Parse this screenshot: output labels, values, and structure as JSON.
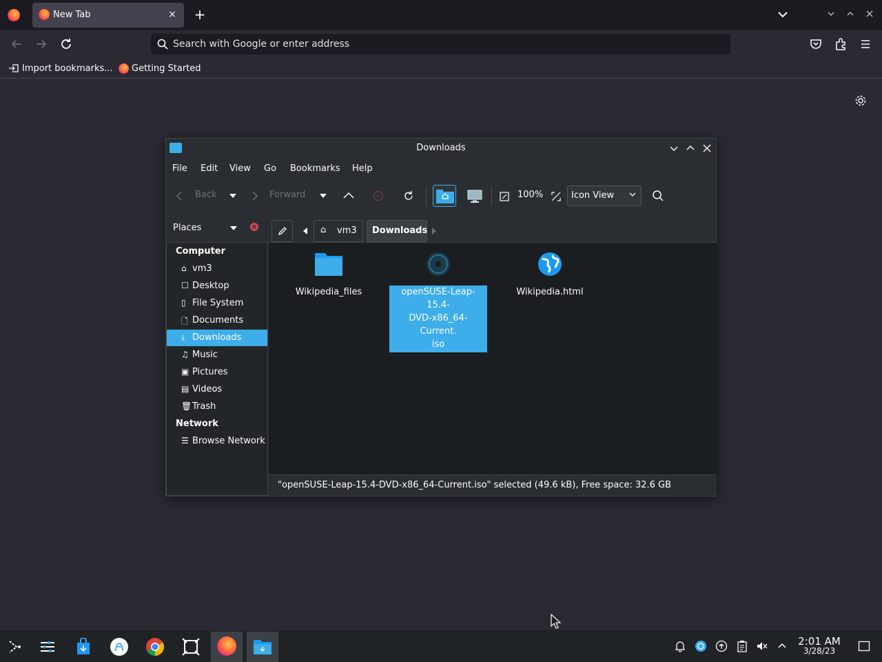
{
  "browser": {
    "tab_title": "New Tab",
    "tab_close": "×",
    "new_tab": "+",
    "url_placeholder": "Search with Google or enter address",
    "bookmarks": [
      "Import bookmarks...",
      "Getting Started"
    ]
  },
  "dolphin": {
    "title": "Downloads",
    "menu": [
      "File",
      "Edit",
      "View",
      "Go",
      "Bookmarks",
      "Help"
    ],
    "toolbar": {
      "back": "Back",
      "forward": "Forward",
      "zoom": "100%",
      "view_mode": "Icon View"
    },
    "places_label": "Places",
    "places": {
      "computer_label": "Computer",
      "computer_items": [
        "vm3",
        "Desktop",
        "File System",
        "Documents",
        "Downloads",
        "Music",
        "Pictures",
        "Videos",
        "Trash"
      ],
      "network_label": "Network",
      "network_items": [
        "Browse Network"
      ],
      "selected": "Downloads"
    },
    "breadcrumb": [
      "vm3",
      "Downloads"
    ],
    "files": [
      {
        "name": "Wikipedia_files",
        "icon": "folder-icon"
      },
      {
        "name_lines": [
          "openSUSE-Leap-15.4-",
          "DVD-x86_64-Current.",
          "iso"
        ],
        "icon": "disc-image-icon",
        "selected": true
      },
      {
        "name": "Wikipedia.html",
        "icon": "globe-icon"
      }
    ],
    "status": "\"openSUSE-Leap-15.4-DVD-x86_64-Current.iso\" selected (49.6 kB), Free space: 32.6 GB"
  },
  "taskbar": {
    "time": "2:01 AM",
    "date": "3/28/23"
  },
  "colors": {
    "accent": "#3daee9",
    "firefox_bg": "#2b2a33",
    "dolphin_bg": "#2a2e32"
  }
}
